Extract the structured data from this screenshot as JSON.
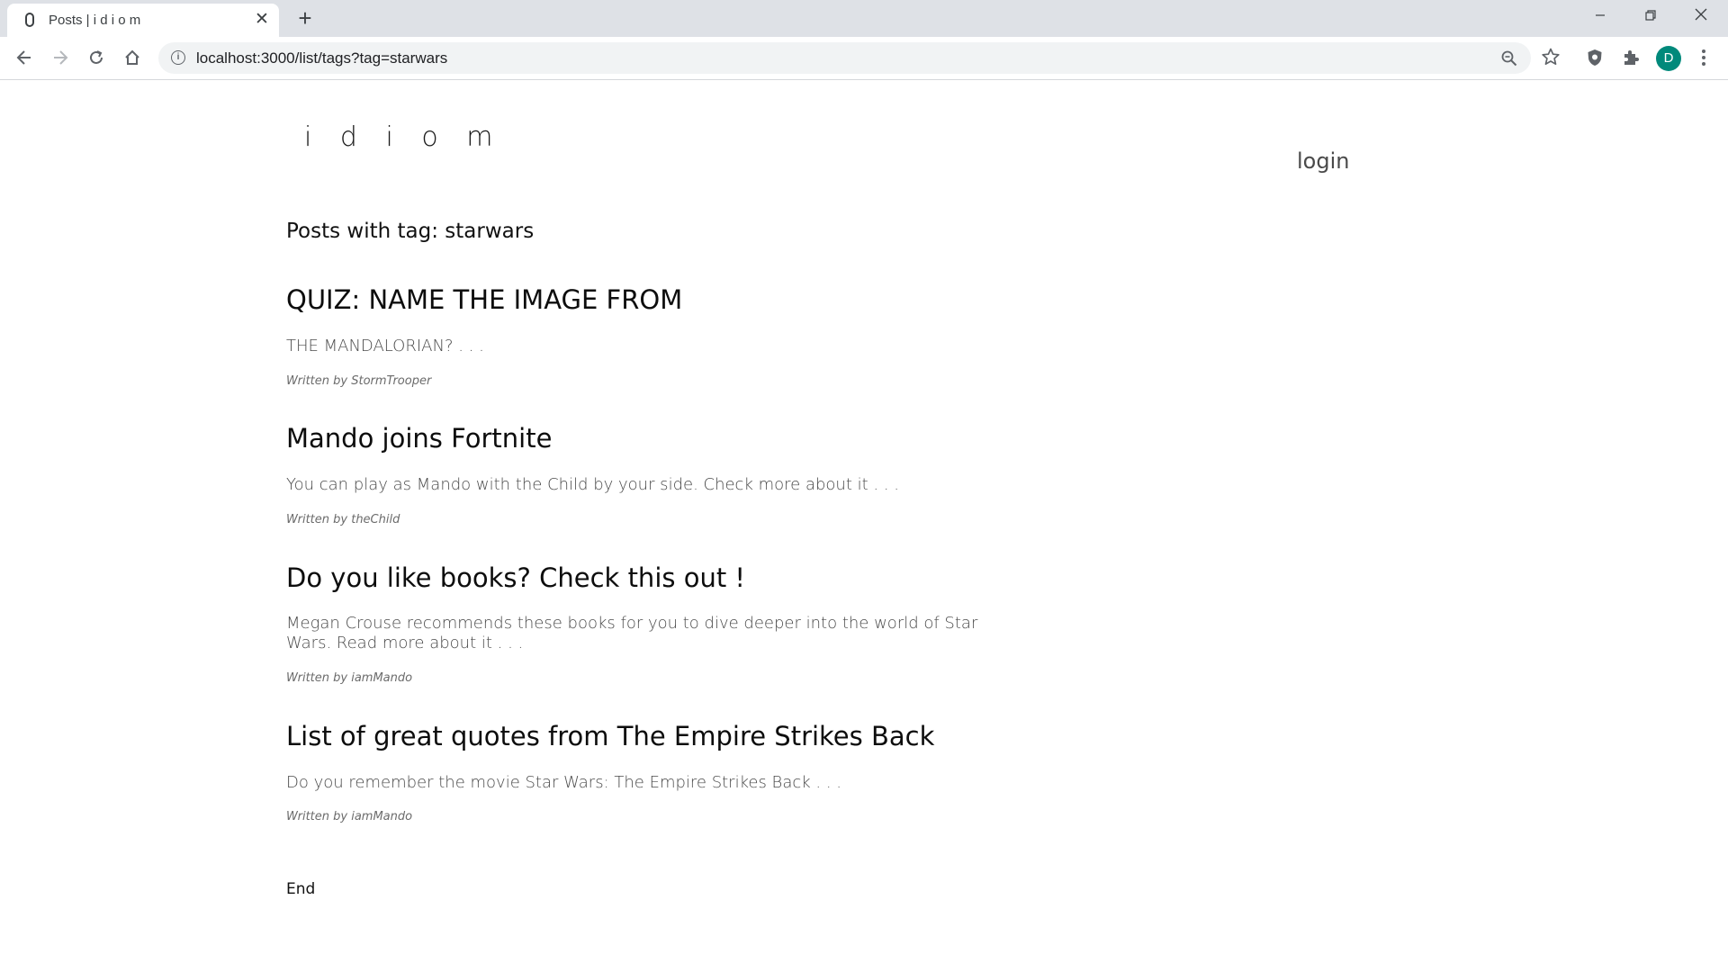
{
  "browser": {
    "tab_title": "Posts | i d i o m",
    "tab_close_glyph": "✕",
    "new_tab_glyph": "+",
    "url": "localhost:3000/list/tags?tag=starwars",
    "profile_initial": "D",
    "icons": {
      "back": "arrow-left-icon",
      "forward": "arrow-right-icon",
      "reload": "reload-icon",
      "home": "home-icon",
      "site_info": "info-icon",
      "zoom": "zoom-icon",
      "bookmark": "star-icon",
      "shield": "shield-extension-icon",
      "extensions": "puzzle-icon",
      "menu": "kebab-menu-icon"
    },
    "avatar_color": "#00897b"
  },
  "site": {
    "logo": "i d i o m",
    "login_label": "login"
  },
  "main": {
    "heading": "Posts with tag: starwars",
    "posts": [
      {
        "title": "QUIZ: NAME THE IMAGE FROM",
        "excerpt": "THE MANDALORIAN? . . .",
        "author": "Written by StormTrooper"
      },
      {
        "title": "Mando joins Fortnite",
        "excerpt": "You can play as Mando with the Child by your side. Check more about it . . .",
        "author": "Written by theChild"
      },
      {
        "title": "Do you like books? Check this out !",
        "excerpt": "Megan Crouse recommends these books for you to dive deeper into the world of Star Wars. Read more about it . . .",
        "author": "Written by iamMando"
      },
      {
        "title": "List of great quotes from The Empire Strikes Back",
        "excerpt": "Do you remember the movie Star Wars: The Empire Strikes Back . . .",
        "author": "Written by iamMando"
      }
    ],
    "end_label": "End"
  }
}
